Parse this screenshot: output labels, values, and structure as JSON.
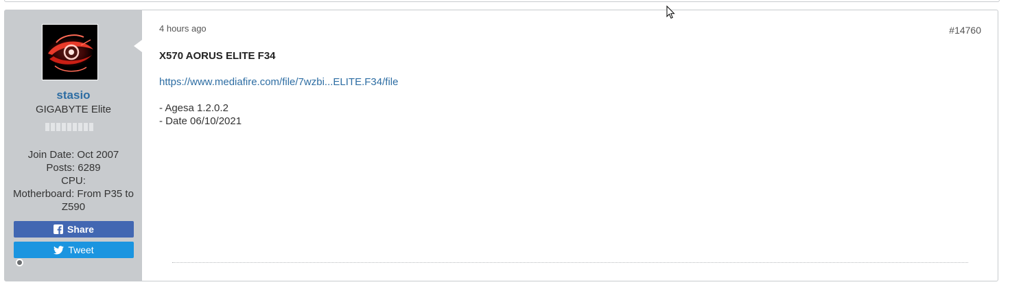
{
  "post": {
    "date": "4 hours ago",
    "number": "#14760",
    "title": "X570 AORUS ELITE F34",
    "link": "https://www.mediafire.com/file/7wzbi...ELITE.F34/file",
    "body_lines": [
      "- Agesa 1.2.0.2",
      "- Date 06/10/2021"
    ]
  },
  "user": {
    "avatar_icon": "gigabyte-eye-logo",
    "name": "stasio",
    "title": "GIGABYTE Elite",
    "reputation_bars": 9,
    "stats": {
      "join_date": "Join Date: Oct 2007",
      "posts": "Posts: 6289",
      "cpu": "CPU:",
      "motherboard": "Motherboard: From P35 to Z590"
    },
    "status": "offline"
  },
  "buttons": {
    "share_label": "Share",
    "share_icon": "facebook-icon",
    "tweet_label": "Tweet",
    "tweet_icon": "twitter-icon"
  },
  "colors": {
    "sidebar_bg": "#c8cbce",
    "username": "#2d6da3",
    "share_bg": "#4267b2",
    "tweet_bg": "#1b95e0",
    "link": "#2d6da3"
  }
}
